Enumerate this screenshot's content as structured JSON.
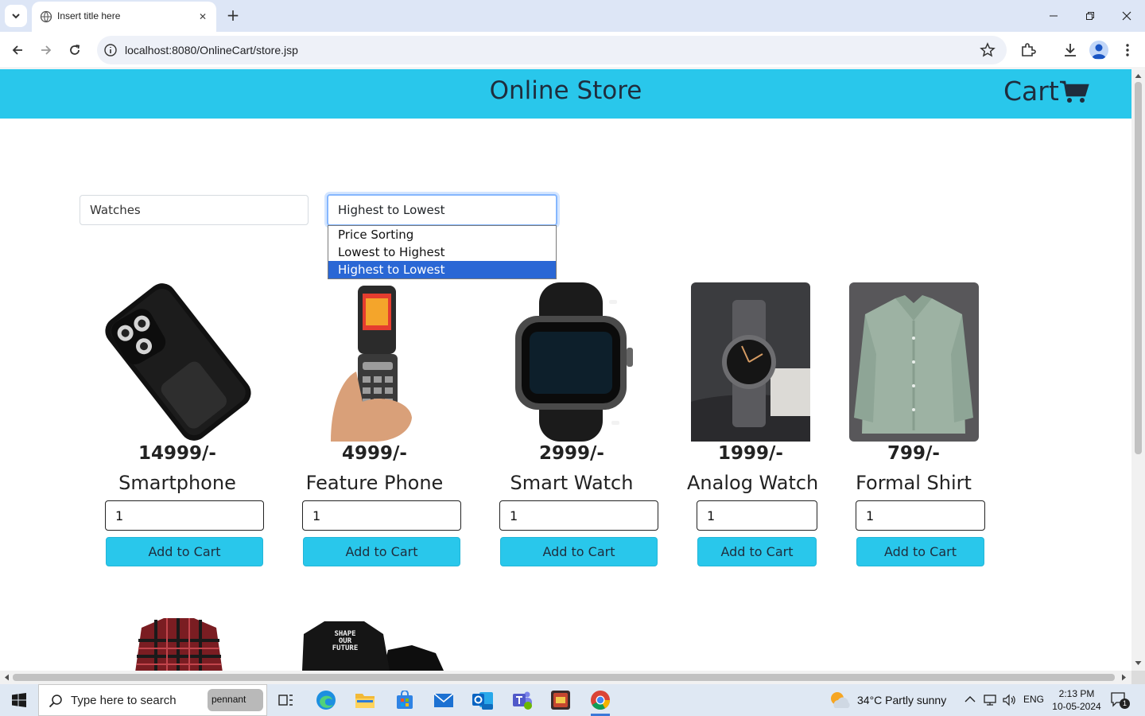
{
  "browser": {
    "tab_title": "Insert title here",
    "url": "localhost:8080/OnlineCart/store.jsp"
  },
  "store": {
    "title": "Online Store",
    "cart_label": "Cart"
  },
  "filters": {
    "category_value": "Watches",
    "sort_value": "Highest to Lowest",
    "sort_options": [
      "Price Sorting",
      "Lowest to Highest",
      "Highest to Lowest"
    ],
    "sort_selected_index": 2
  },
  "products": [
    {
      "price": "14999/-",
      "name": "Smartphone",
      "qty": "1",
      "button": "Add to Cart"
    },
    {
      "price": "4999/-",
      "name": "Feature Phone",
      "qty": "1",
      "button": "Add to Cart"
    },
    {
      "price": "2999/-",
      "name": "Smart Watch",
      "qty": "1",
      "button": "Add to Cart"
    },
    {
      "price": "1999/-",
      "name": "Analog Watch",
      "qty": "1",
      "button": "Add to Cart"
    },
    {
      "price": "799/-",
      "name": "Formal Shirt",
      "qty": "1",
      "button": "Add to Cart"
    }
  ],
  "partial_products": [
    {
      "image_text": "SHAPE\nOUR\nFUTURE"
    }
  ],
  "taskbar": {
    "search_placeholder": "Type here to search",
    "pennant": "pennant",
    "weather": "34°C  Partly sunny",
    "lang": "ENG",
    "time": "2:13 PM",
    "date": "10-05-2024",
    "notifications": "1"
  },
  "colors": {
    "accent": "#29c7eb",
    "selected_option": "#2a67d5"
  }
}
